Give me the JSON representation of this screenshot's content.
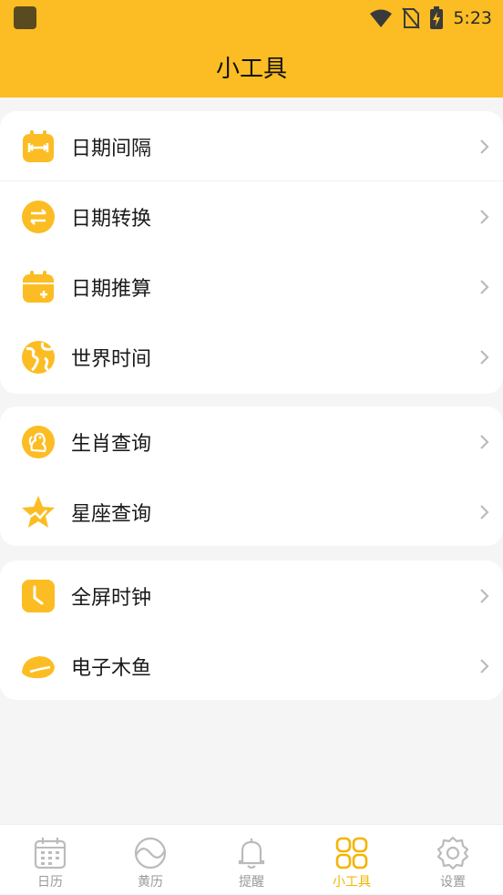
{
  "status": {
    "time": "5:23"
  },
  "header": {
    "title": "小工具"
  },
  "groups": [
    {
      "items": [
        {
          "label": "日期间隔",
          "icon": "date-interval-icon"
        },
        {
          "label": "日期转换",
          "icon": "date-convert-icon"
        },
        {
          "label": "日期推算",
          "icon": "date-calc-icon"
        },
        {
          "label": "世界时间",
          "icon": "globe-icon"
        }
      ]
    },
    {
      "items": [
        {
          "label": "生肖查询",
          "icon": "zodiac-icon"
        },
        {
          "label": "星座查询",
          "icon": "star-constellation-icon"
        }
      ]
    },
    {
      "items": [
        {
          "label": "全屏时钟",
          "icon": "clock-icon"
        },
        {
          "label": "电子木鱼",
          "icon": "wooden-fish-icon"
        }
      ]
    }
  ],
  "tabs": [
    {
      "label": "日历",
      "icon": "calendar-icon",
      "active": false
    },
    {
      "label": "黄历",
      "icon": "almanac-icon",
      "active": false
    },
    {
      "label": "提醒",
      "icon": "bell-icon",
      "active": false
    },
    {
      "label": "小工具",
      "icon": "tools-grid-icon",
      "active": true
    },
    {
      "label": "设置",
      "icon": "settings-icon",
      "active": false
    }
  ],
  "colors": {
    "accent": "#fbbd23",
    "icon_fill": "#fbbd23",
    "tab_active": "#f4b400",
    "tab_inactive": "#999999"
  }
}
